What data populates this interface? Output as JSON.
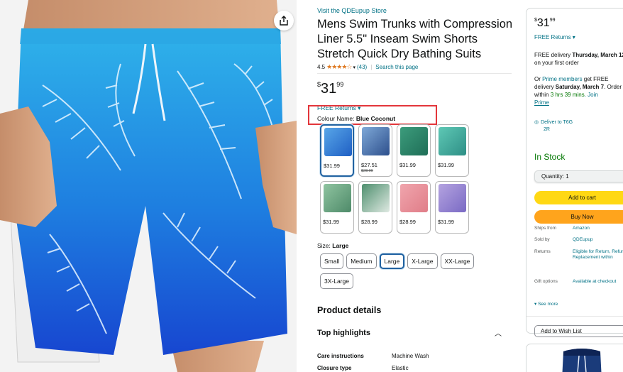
{
  "gallery": {
    "share_icon": "share-icon",
    "image_alt": "Blue Coconut swim trunks"
  },
  "product": {
    "store_link": "Visit the QDEupup Store",
    "title": "Mens Swim Trunks with Compression Liner 5.5\" Inseam Swim Shorts Stretch Quick Dry Bathing Suits",
    "rating": "4.5",
    "stars": "★★★★☆",
    "rating_count": "(43)",
    "separator": "|",
    "search_link": "Search this page",
    "price_symbol": "$",
    "price_whole": "31",
    "price_fraction": "99",
    "free_returns": "FREE Returns ▾",
    "colour_label": "Colour Name: ",
    "colour_value": "Blue Coconut",
    "swatches": [
      {
        "price": "$31.99",
        "strike": "",
        "selected": true,
        "color_a": "#58a6e8",
        "color_b": "#1f5fc4"
      },
      {
        "price": "$27.51",
        "strike": "$28.99",
        "selected": false,
        "color_a": "#7fa9d8",
        "color_b": "#2d4f8c"
      },
      {
        "price": "$31.99",
        "strike": "",
        "selected": false,
        "color_a": "#3c9c7c",
        "color_b": "#1f6e57"
      },
      {
        "price": "$31.99",
        "strike": "",
        "selected": false,
        "color_a": "#5ec8b5",
        "color_b": "#2e8f86"
      },
      {
        "price": "$31.99",
        "strike": "",
        "selected": false,
        "color_a": "#8fc4a0",
        "color_b": "#4e8a69"
      },
      {
        "price": "$28.99",
        "strike": "",
        "selected": false,
        "color_a": "#4e8f6e",
        "color_b": "#dfe9e2"
      },
      {
        "price": "$28.99",
        "strike": "",
        "selected": false,
        "color_a": "#f0a5ad",
        "color_b": "#e07d88"
      },
      {
        "price": "$31.99",
        "strike": "",
        "selected": false,
        "color_a": "#b4a3e0",
        "color_b": "#7a6ac4"
      }
    ],
    "size_label": "Size: ",
    "size_value": "Large",
    "sizes": [
      "Small",
      "Medium",
      "Large",
      "X-Large",
      "XX-Large",
      "3X-Large"
    ],
    "selected_size": "Large",
    "details_heading": "Product details",
    "top_highlights": "Top highlights",
    "chevron_up": "︿",
    "attributes": [
      {
        "key": "Care instructions",
        "value": "Machine Wash"
      },
      {
        "key": "Closure type",
        "value": "Elastic"
      }
    ]
  },
  "buybox": {
    "price_symbol": "$",
    "price_whole": "31",
    "price_fraction": "99",
    "returns": "FREE Returns ▾",
    "delivery_prefix": "FREE delivery ",
    "delivery_date": "Thursday, March",
    "delivery_date2": "12",
    "delivery_suffix": " on your first order",
    "prime_prefix": "Or ",
    "prime_link": "Prime members",
    "prime_mid": " get FREE delivery ",
    "prime_date": "Saturday, March 7",
    "prime_order": ". Order within ",
    "prime_time": "3 hrs 39 mins",
    "prime_join": ". Join",
    "prime_word": "Prime",
    "deliver_to": "Deliver to  T6G",
    "deliver_to2": "2R",
    "stock": "In Stock",
    "quantity": "Quantity: 1",
    "add_to_cart": "Add to cart",
    "buy_now": "Buy Now",
    "info": [
      {
        "key": "Ships from",
        "value": "Amazon"
      },
      {
        "key": "Sold by",
        "value": "QDEupup"
      },
      {
        "key": "Returns",
        "value": "Eligible for Return, Refund or Replacement within"
      },
      {
        "key": "Gift options",
        "value": "Available at checkout"
      }
    ],
    "see_more": "▾ See more",
    "wish_list": "Add to Wish List"
  },
  "colors": {
    "link": "#007185",
    "stock": "#007600",
    "cart": "#ffd814",
    "buy": "#ffa41c",
    "highlight": "#e3363b",
    "selected": "#2162a1"
  }
}
